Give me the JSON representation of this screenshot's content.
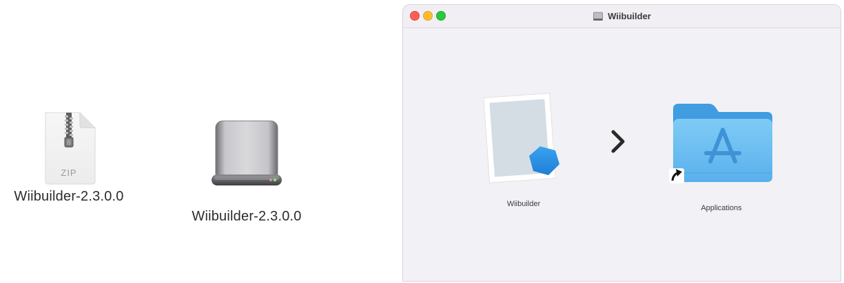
{
  "desktop": {
    "zip": {
      "label": "Wiibuilder-2.3.0.0",
      "badge": "ZIP",
      "icon": "zip-archive-icon"
    },
    "dmg": {
      "label": "Wiibuilder-2.3.0.0",
      "icon": "disk-image-icon"
    }
  },
  "window": {
    "title": "Wiibuilder",
    "title_icon": "disk-icon",
    "items": {
      "app": {
        "label": "Wiibuilder",
        "icon": "wiibuilder-app-icon"
      },
      "applications": {
        "label": "Applications",
        "icon": "applications-folder-icon"
      }
    },
    "arrow_icon": "chevron-right-icon"
  },
  "colors": {
    "close": "#fe5f57",
    "minimize": "#febc2e",
    "maximize": "#28c840",
    "folder": "#5fb6ee",
    "app_hex": "#2a8fe3"
  }
}
